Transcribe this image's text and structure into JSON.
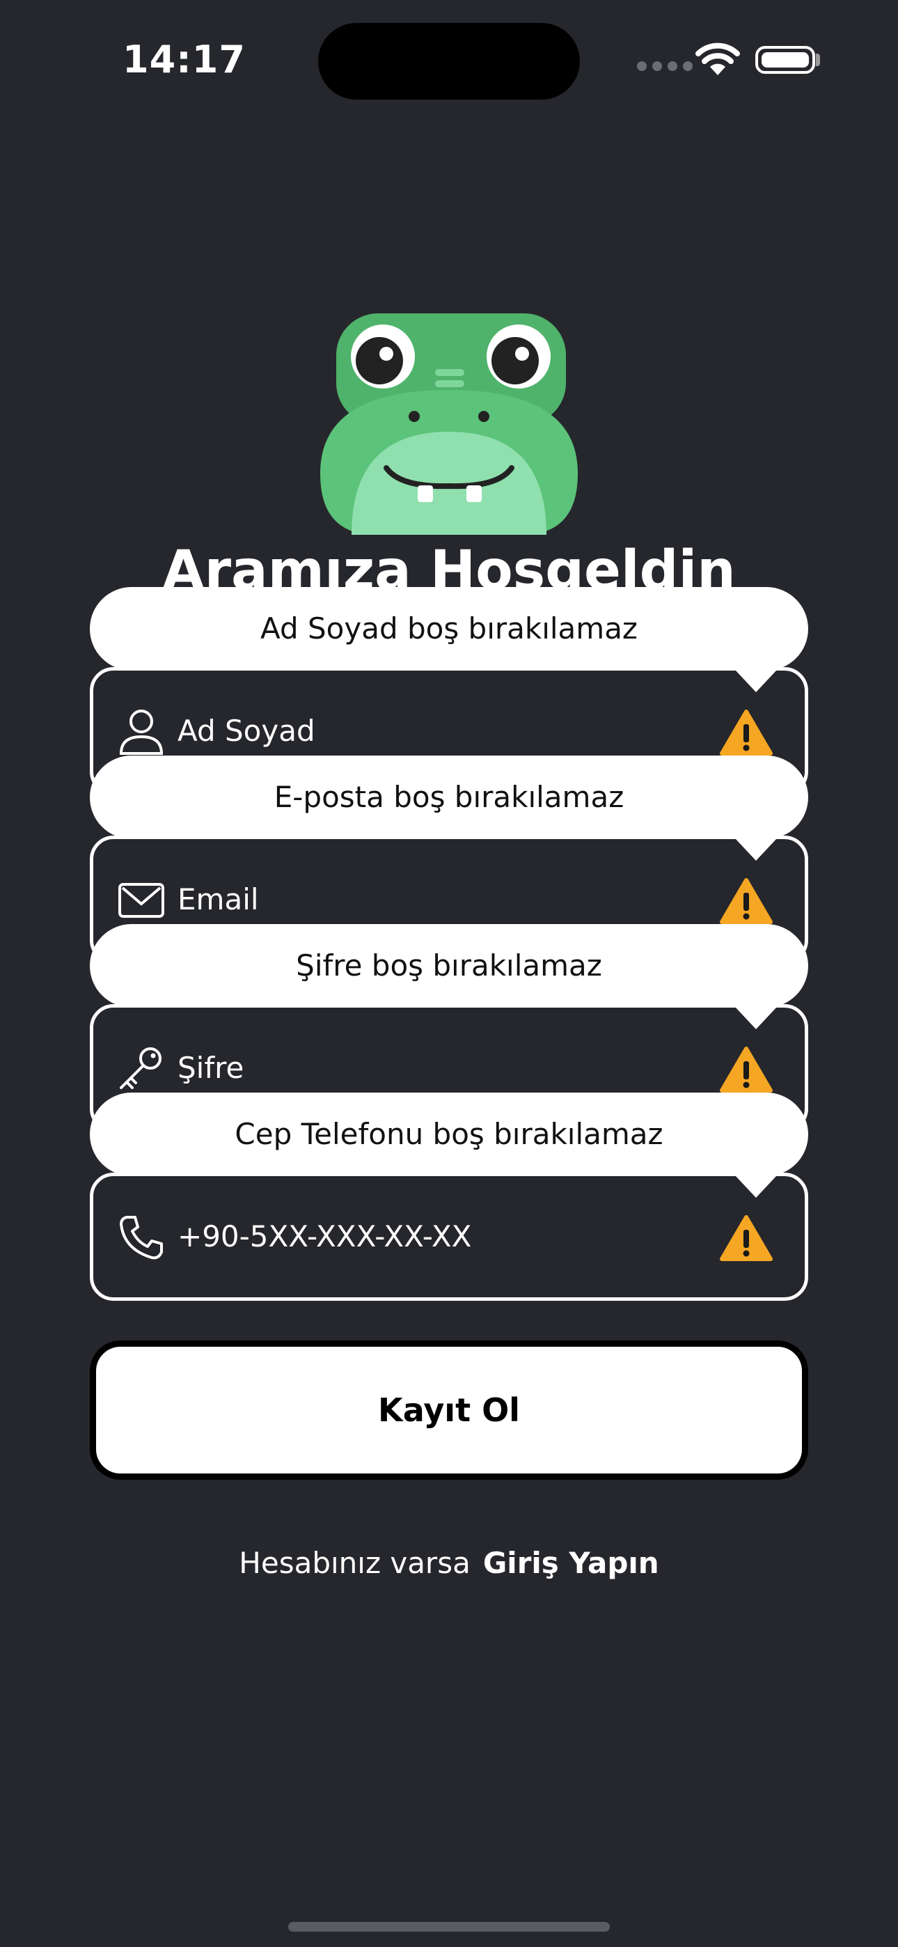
{
  "status_bar": {
    "time": "14:17"
  },
  "header": {
    "title": "Aramıza Hoşgeldin"
  },
  "form": {
    "fields": [
      {
        "placeholder": "Ad Soyad",
        "icon": "person-icon",
        "error": "Ad Soyad boş bırakılamaz"
      },
      {
        "placeholder": "Email",
        "icon": "envelope-icon",
        "error": "E-posta boş bırakılamaz"
      },
      {
        "placeholder": "Şifre",
        "icon": "key-icon",
        "error": "Şifre boş bırakılamaz"
      },
      {
        "placeholder": "+90-5XX-XXX-XX-XX",
        "icon": "phone-icon",
        "error": "Cep Telefonu boş bırakılamaz"
      }
    ],
    "submit_label": "Kayıt Ol"
  },
  "footer": {
    "prompt": "Hesabınız varsa",
    "link": "Giriş Yapın"
  },
  "colors": {
    "background": "#26272c",
    "accent_green": "#5cc37a",
    "warning": "#f5a623",
    "border": "#ffffff"
  }
}
